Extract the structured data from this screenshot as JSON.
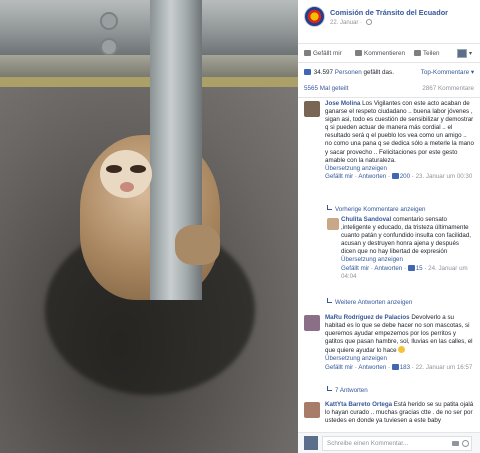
{
  "photo": {
    "icon": "sloth-photo"
  },
  "post": {
    "page_name": "Comisión de Tránsito del Ecuador",
    "date": "22. Januar"
  },
  "actions": {
    "like": "Gefällt mir",
    "comment": "Kommentieren",
    "share": "Teilen"
  },
  "stats": {
    "likes_count": "34.597",
    "likes_persons": "Personen",
    "likes_suffix": "gefällt das.",
    "top_comments": "Top-Kommentare",
    "shares": "5565 Mal geteilt",
    "comment_count": "2867 Kommentare"
  },
  "comments": [
    {
      "author": "Jose Molina",
      "text": "Los Vigilantes con este acto acaban de ganarse el respeto ciudadano .. buena labor jóvenes , sigan asi, todo es cuestión de sensibilizar y demostrar q si pueden actuar de manera más cordial .. el resultado será q el pueblo los vea como un amigo .. no como una pana q se dedica sólo a meterle la mano y sacar provecho .. Felicitaciones por este gesto amable con la naturaleza.",
      "translation": "Übersetzung anzeigen",
      "like": "Gefällt mir",
      "reply": "Antworten",
      "likes": "200",
      "time": "23. Januar um 00:30"
    },
    {
      "link": "Vorherige Kommentare anzeigen"
    },
    {
      "author": "Chulita Sandoval",
      "text": "comentario sensato ,inteligente y educado, da tristeza últimamente cuanto patán y confundido insulta con facilidad, acusan y destruyen honra ajena y después dicen que no hay libertad de expresión",
      "translation": "Übersetzung anzeigen",
      "like": "Gefällt mir",
      "reply": "Antworten",
      "likes": "15",
      "time": "24. Januar um 04:04"
    },
    {
      "link": "Weitere Antworten anzeigen"
    },
    {
      "author": "MaRu Rodríguez de Palacios",
      "text": "Devolverlo a su habitad es lo que se debe hacer no son mascotas, si queremos ayudar empezemos por los perritos y gatitos que pasan hambre, sol, lluvias en las calles, el que quiere ayudar lo hace",
      "translation": "Übersetzung anzeigen",
      "like": "Gefällt mir",
      "reply": "Antworten",
      "likes": "183",
      "time": "22. Januar um 16:57"
    },
    {
      "link": "7 Antworten"
    },
    {
      "author": "KattYta Barreto Ortega",
      "text": "Está herido se su patita ojalá lo hayan curado .. muchas gracias ctte . de no ser por ustedes en donde ya tuviesen a este baby"
    }
  ],
  "composer": {
    "placeholder": "Schreibe einen Kommentar..."
  }
}
